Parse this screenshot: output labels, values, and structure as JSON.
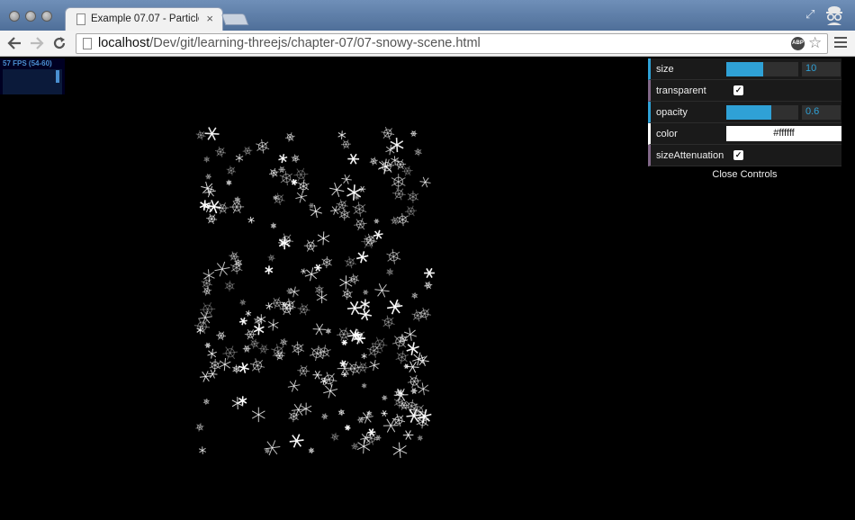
{
  "browser": {
    "tab_title": "Example 07.07 - Particles",
    "tab_close": "×",
    "url_host": "localhost",
    "url_path": "/Dev/git/learning-threejs/chapter-07/07-snowy-scene.html",
    "ext_badge": "ABP",
    "icons": {
      "back": "back-arrow-icon",
      "forward": "forward-arrow-icon",
      "reload": "reload-icon",
      "star": "bookmark-star-icon",
      "menu": "hamburger-menu-icon"
    }
  },
  "stats": {
    "fps_text": "57 FPS (54-60)"
  },
  "gui": {
    "rows": [
      {
        "label": "size",
        "type": "number",
        "value": "10",
        "fraction": 0.5
      },
      {
        "label": "transparent",
        "type": "boolean",
        "checked": true
      },
      {
        "label": "opacity",
        "type": "number",
        "value": "0.6",
        "fraction": 0.6
      },
      {
        "label": "color",
        "type": "color",
        "value": "#ffffff"
      },
      {
        "label": "sizeAttenuation",
        "type": "boolean",
        "checked": true
      }
    ],
    "close_label": "Close Controls"
  },
  "colors": {
    "titlebar": "#5a7ba6",
    "gui_number_accent": "#2fa1d6",
    "gui_bool_accent": "#806787",
    "fps_text": "#4a8fd0"
  }
}
